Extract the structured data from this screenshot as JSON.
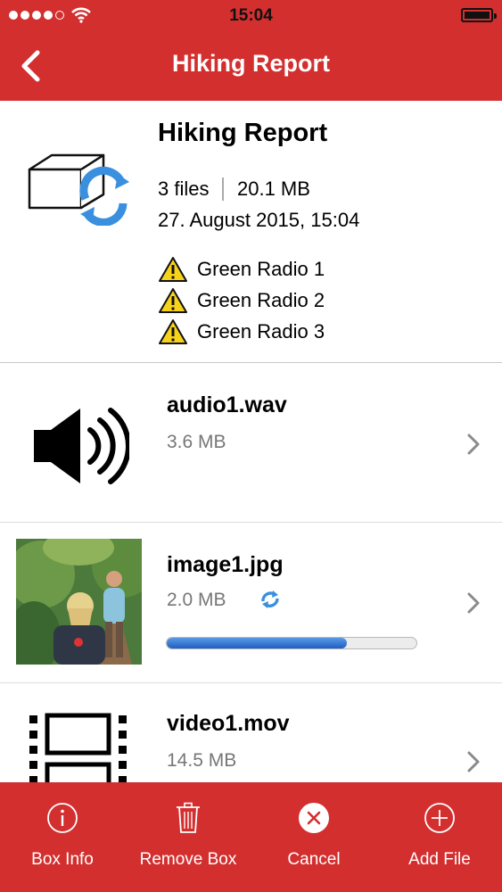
{
  "status_bar": {
    "time": "15:04"
  },
  "nav": {
    "title": "Hiking Report"
  },
  "box": {
    "title": "Hiking Report",
    "files_count": "3 files",
    "total_size": "20.1 MB",
    "date": "27. August 2015, 15:04",
    "warnings": [
      "Green Radio 1",
      "Green Radio 2",
      "Green Radio 3"
    ]
  },
  "files": [
    {
      "name": "audio1.wav",
      "size": "3.6 MB",
      "icon": "speaker-icon"
    },
    {
      "name": "image1.jpg",
      "size": "2.0 MB",
      "icon": "image-thumbnail",
      "upload_progress": 0.72
    },
    {
      "name": "video1.mov",
      "size": "14.5 MB",
      "icon": "film-icon"
    }
  ],
  "toolbar": {
    "box_info": "Box Info",
    "remove_box": "Remove Box",
    "cancel": "Cancel",
    "add_file": "Add File"
  },
  "colors": {
    "brand": "#d32f2f",
    "sync_blue": "#3a8fde",
    "progress": "#2f6fd1",
    "warning": "#f6d21c"
  }
}
